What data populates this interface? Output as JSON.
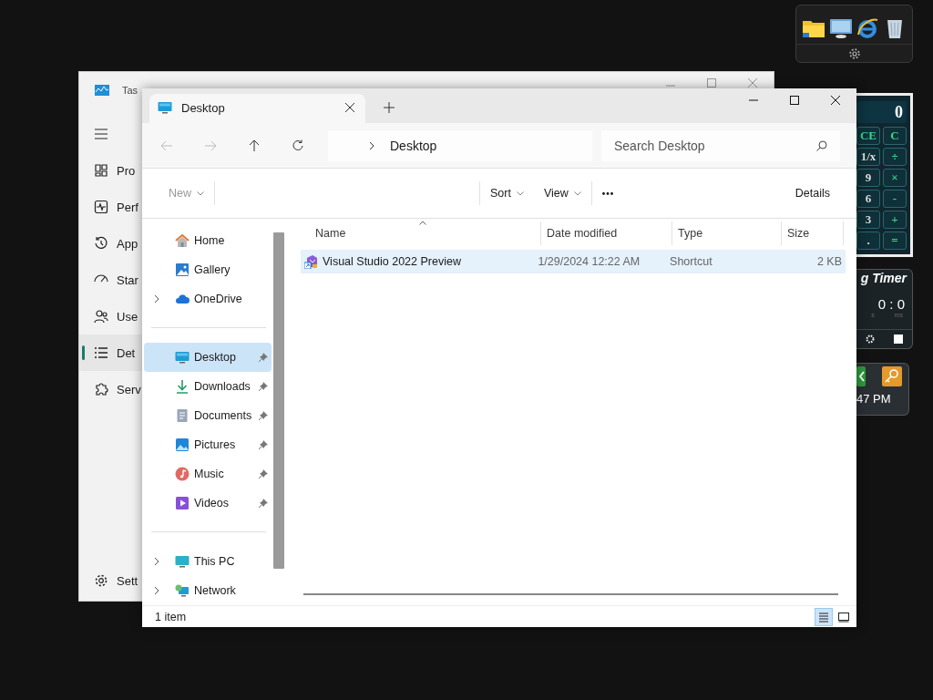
{
  "gadgets": {
    "calculator": {
      "display": "0",
      "keys": [
        "CE",
        "C",
        "1/x",
        "÷",
        "9",
        "×",
        "6",
        "-",
        "3",
        "+",
        ".",
        "="
      ]
    },
    "timer": {
      "title": "g Timer",
      "reading": "0 : 0",
      "units": [
        "s",
        "ms"
      ]
    },
    "clock": {
      "time": "47 PM"
    }
  },
  "task_manager": {
    "title": "Tas",
    "nav": [
      {
        "label": "Pro",
        "selected": false
      },
      {
        "label": "Perf",
        "selected": false
      },
      {
        "label": "App",
        "selected": false
      },
      {
        "label": "Star",
        "selected": false
      },
      {
        "label": "Use",
        "selected": false
      },
      {
        "label": "Det",
        "selected": true
      },
      {
        "label": "Serv",
        "selected": false
      }
    ],
    "settings": "Sett"
  },
  "explorer": {
    "tabs": [
      {
        "title": "Desktop",
        "selected": true
      }
    ],
    "breadcrumb": [
      "Desktop"
    ],
    "search": {
      "placeholder": "Search Desktop"
    },
    "commands": [
      {
        "label": "New",
        "disabled": true,
        "dropdown": true
      },
      {
        "label": "Sort",
        "disabled": false,
        "dropdown": true
      },
      {
        "label": "View",
        "disabled": false,
        "dropdown": true
      }
    ],
    "more": "•••",
    "details": "Details",
    "sidebar": [
      {
        "items": [
          {
            "label": "Home",
            "selected": false,
            "expandable": false,
            "pinned": false
          },
          {
            "label": "Gallery",
            "selected": false,
            "expandable": false,
            "pinned": false
          },
          {
            "label": "OneDrive",
            "selected": false,
            "expandable": true,
            "pinned": false
          }
        ]
      },
      {
        "items": [
          {
            "label": "Desktop",
            "selected": true,
            "expandable": false,
            "pinned": true
          },
          {
            "label": "Downloads",
            "selected": false,
            "expandable": false,
            "pinned": true
          },
          {
            "label": "Documents",
            "selected": false,
            "expandable": false,
            "pinned": true
          },
          {
            "label": "Pictures",
            "selected": false,
            "expandable": false,
            "pinned": true
          },
          {
            "label": "Music",
            "selected": false,
            "expandable": false,
            "pinned": true
          },
          {
            "label": "Videos",
            "selected": false,
            "expandable": false,
            "pinned": true
          }
        ]
      },
      {
        "items": [
          {
            "label": "This PC",
            "selected": false,
            "expandable": true,
            "pinned": false
          },
          {
            "label": "Network",
            "selected": false,
            "expandable": true,
            "pinned": false
          }
        ]
      }
    ],
    "table": {
      "columns": [
        "Name",
        "Date modified",
        "Type",
        "Size"
      ],
      "rows": [
        {
          "name": "Visual Studio 2022 Preview",
          "date": "1/29/2024 12:22 AM",
          "type": "Shortcut",
          "size": "2 KB",
          "selected": true
        }
      ]
    },
    "status": "1 item",
    "views": [
      {
        "selected": true
      },
      {
        "selected": false
      }
    ]
  }
}
